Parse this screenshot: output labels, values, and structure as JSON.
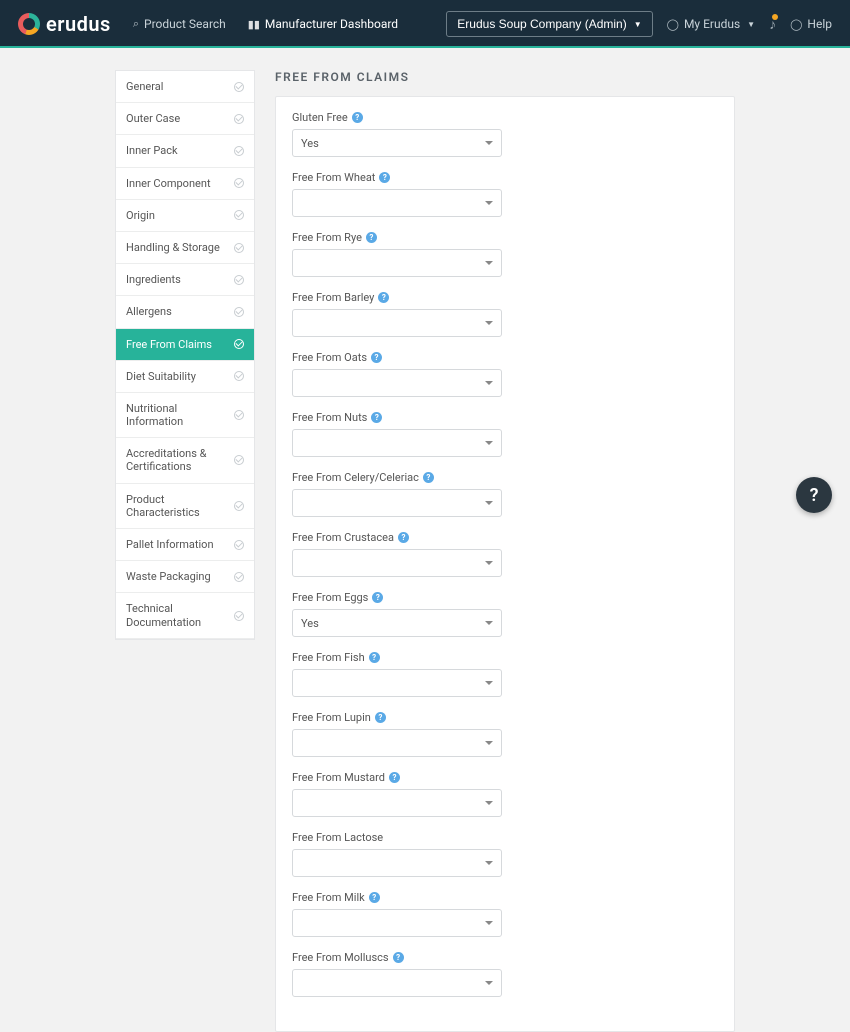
{
  "header": {
    "brand": "erudus",
    "navProductSearch": "Product Search",
    "navDashboard": "Manufacturer Dashboard",
    "adminLabel": "Erudus Soup Company (Admin)",
    "myAccount": "My Erudus",
    "help": "Help"
  },
  "sidebar": {
    "items": [
      {
        "label": "General"
      },
      {
        "label": "Outer Case"
      },
      {
        "label": "Inner Pack"
      },
      {
        "label": "Inner Component"
      },
      {
        "label": "Origin"
      },
      {
        "label": "Handling & Storage"
      },
      {
        "label": "Ingredients"
      },
      {
        "label": "Allergens"
      },
      {
        "label": "Free From Claims"
      },
      {
        "label": "Diet Suitability"
      },
      {
        "label": "Nutritional Information"
      },
      {
        "label": "Accreditations & Certifications"
      },
      {
        "label": "Product Characteristics"
      },
      {
        "label": "Pallet Information"
      },
      {
        "label": "Waste Packaging"
      },
      {
        "label": "Technical Documentation"
      }
    ],
    "activeIndex": 8
  },
  "form": {
    "title": "FREE FROM CLAIMS",
    "left": [
      {
        "label": "Gluten Free",
        "value": "Yes",
        "help": true
      },
      {
        "label": "Free From Wheat",
        "value": "",
        "help": true
      },
      {
        "label": "Free From Rye",
        "value": "",
        "help": true
      },
      {
        "label": "Free From Barley",
        "value": "",
        "help": true
      },
      {
        "label": "Free From Oats",
        "value": "",
        "help": true
      },
      {
        "label": "Free From Nuts",
        "value": "",
        "help": true
      }
    ],
    "right": [
      {
        "label": "Free From Celery/Celeriac",
        "value": "",
        "help": true
      },
      {
        "label": "Free From Crustacea",
        "value": "",
        "help": true
      },
      {
        "label": "Free From Eggs",
        "value": "Yes",
        "help": true
      },
      {
        "label": "Free From Fish",
        "value": "",
        "help": true
      },
      {
        "label": "Free From Lupin",
        "value": "",
        "help": true
      },
      {
        "label": "Free From Mustard",
        "value": "",
        "help": true
      },
      {
        "label": "Free From Lactose",
        "value": "",
        "help": false
      },
      {
        "label": "Free From Milk",
        "value": "",
        "help": true
      },
      {
        "label": "Free From Molluscs",
        "value": "",
        "help": true
      }
    ]
  }
}
